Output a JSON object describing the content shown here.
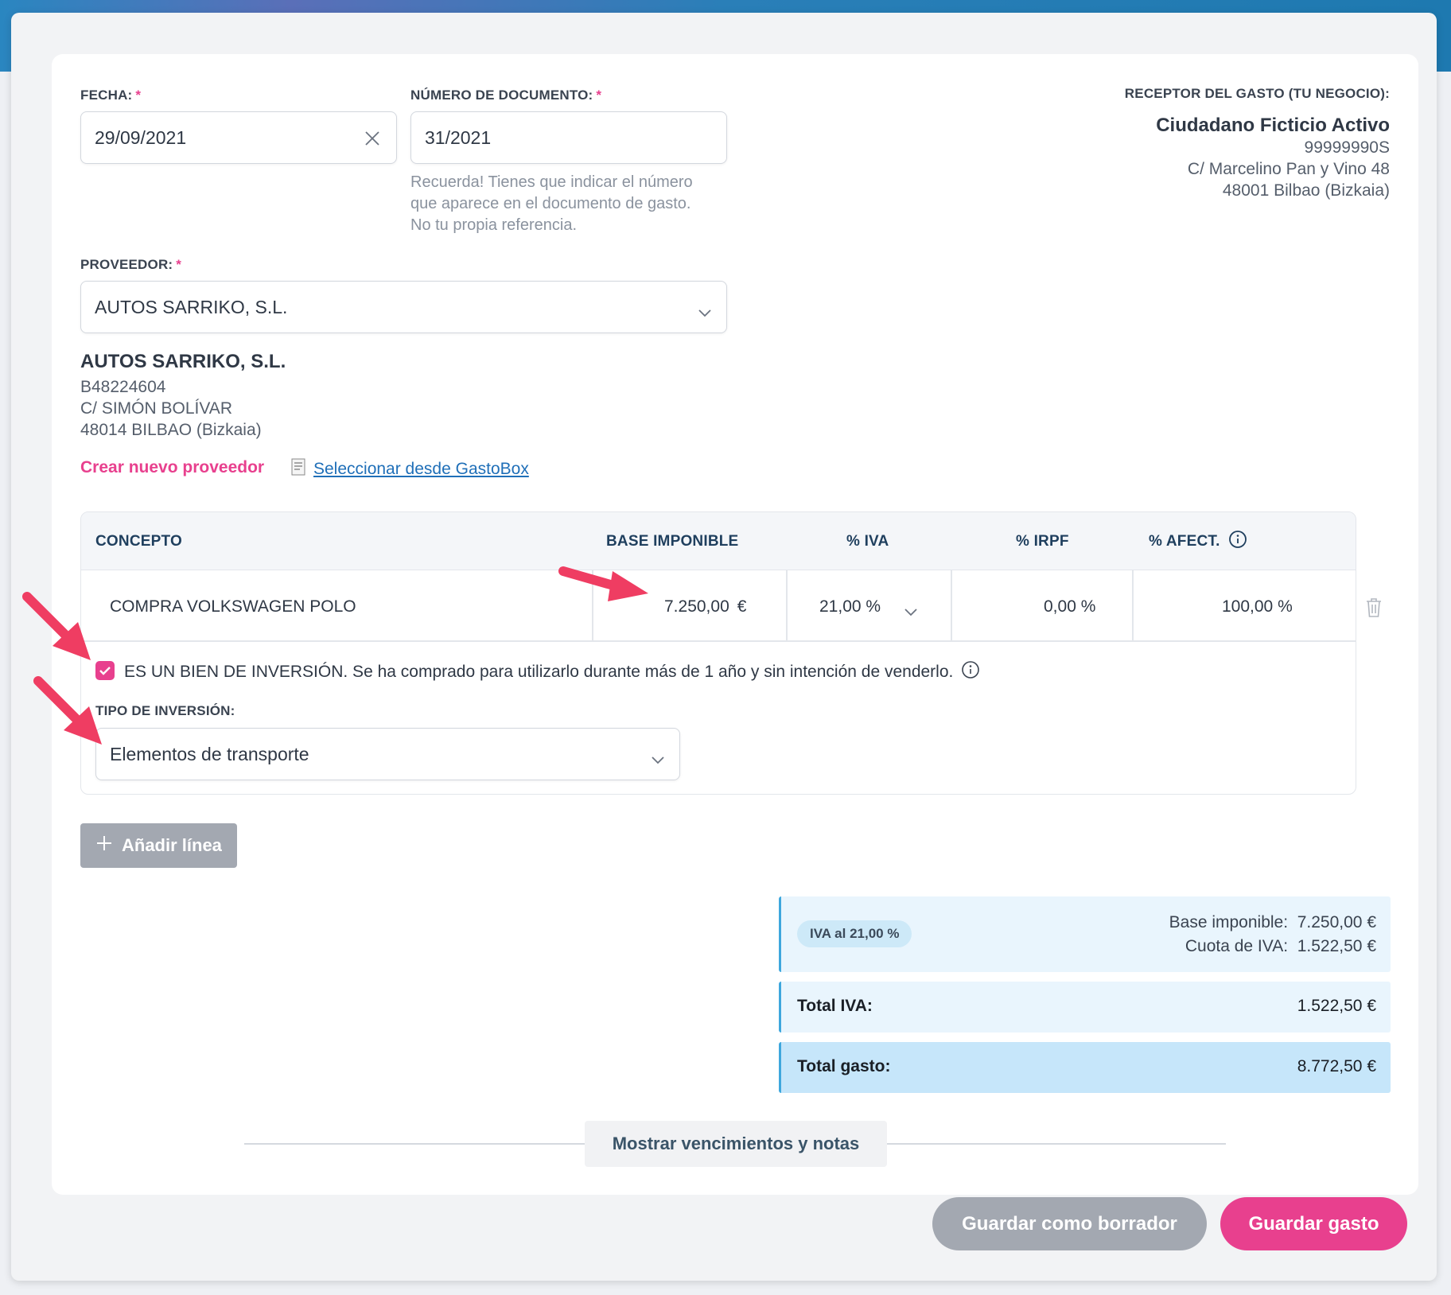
{
  "form": {
    "fecha_label": "FECHA:",
    "fecha_value": "29/09/2021",
    "numero_label": "NÚMERO DE DOCUMENTO:",
    "numero_value": "31/2021",
    "numero_hint_1": "Recuerda! Tienes que indicar el número",
    "numero_hint_2": "que aparece en el documento de gasto.",
    "numero_hint_3": "No tu propia referencia.",
    "required_mark": "*",
    "proveedor_label": "PROVEEDOR:",
    "proveedor_value": "AUTOS SARRIKO, S.L."
  },
  "receptor": {
    "label": "RECEPTOR DEL GASTO (TU NEGOCIO):",
    "name": "Ciudadano Ficticio Activo",
    "nif": "99999990S",
    "address_1": "C/ Marcelino Pan y Vino 48",
    "address_2": "48001 Bilbao (Bizkaia)"
  },
  "proveedor_info": {
    "name": "AUTOS SARRIKO, S.L.",
    "nif": "B48224604",
    "address_1": "C/ SIMÓN BOLÍVAR",
    "address_2": "48014 BILBAO (Bizkaia)",
    "create_link": "Crear nuevo proveedor",
    "select_link": "Seleccionar desde GastoBox"
  },
  "table": {
    "headers": {
      "concepto": "CONCEPTO",
      "base": "BASE IMPONIBLE",
      "iva": "% IVA",
      "irpf": "% IRPF",
      "afect": "% AFECT."
    },
    "row": {
      "concepto": "COMPRA VOLKSWAGEN POLO",
      "base": "7.250,00",
      "currency": "€",
      "iva": "21,00 %",
      "irpf": "0,00 %",
      "afect": "100,00 %"
    },
    "inversion_checkbox_text": "ES UN BIEN DE INVERSIÓN. Se ha comprado para utilizarlo durante más de 1 año y sin intención de venderlo.",
    "tipo_label": "TIPO DE INVERSIÓN:",
    "tipo_value": "Elementos de transporte"
  },
  "actions": {
    "add_line": "Añadir línea",
    "show_more": "Mostrar vencimientos y notas",
    "save_draft": "Guardar como borrador",
    "save": "Guardar gasto"
  },
  "summary": {
    "iva_pill": "IVA al 21,00 %",
    "base_label": "Base imponible:",
    "base_value": "7.250,00 €",
    "cuota_label": "Cuota de IVA:",
    "cuota_value": "1.522,50 €",
    "total_iva_label": "Total IVA:",
    "total_iva_value": "1.522,50 €",
    "total_gasto_label": "Total gasto:",
    "total_gasto_value": "8.772,50 €"
  },
  "colors": {
    "accent_pink": "#e8408e",
    "link_blue": "#1f6fb8",
    "header_navy": "#1f3f5e",
    "summary_bg": "#e9f5fd",
    "summary_total_bg": "#c6e6fa",
    "arrow_red": "#ef3d62"
  }
}
